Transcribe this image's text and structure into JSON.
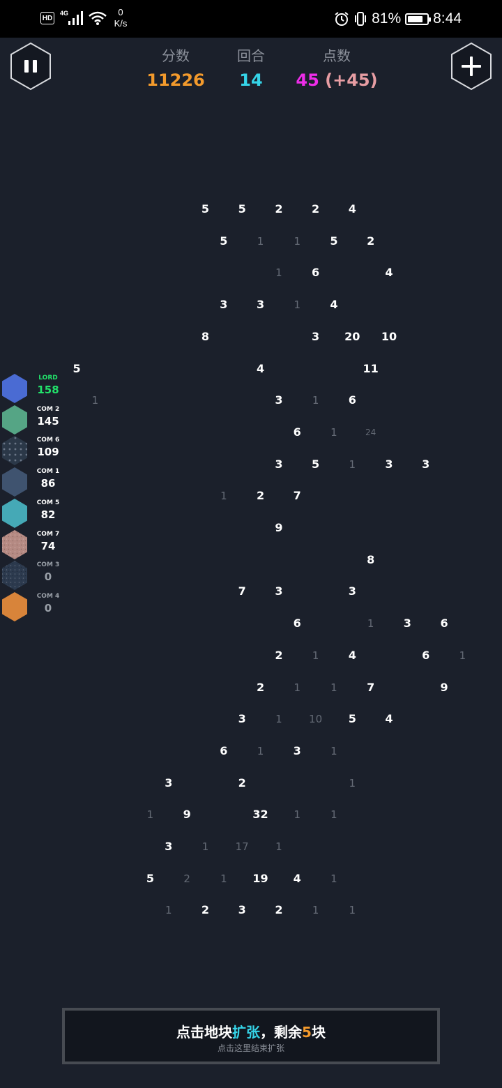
{
  "status_bar": {
    "hd": "HD",
    "network": "4G",
    "speed_value": "0",
    "speed_unit": "K/s",
    "battery": "81%",
    "battery_level": 0.81,
    "time": "8:44"
  },
  "hud": {
    "score_label": "分数",
    "score_value": "11226",
    "round_label": "回合",
    "round_value": "14",
    "points_label": "点数",
    "points_value": "45",
    "points_bonus": "(+45)",
    "colors": {
      "score": "#f39a2c",
      "round": "#35d4e8",
      "points": "#ee2de9",
      "bonus": "#e79da3"
    }
  },
  "board": {
    "cells": [
      {
        "row": 0,
        "col": 0,
        "text": "5"
      },
      {
        "row": 0,
        "col": 2,
        "text": "5"
      },
      {
        "row": 0,
        "col": 4,
        "text": "2"
      },
      {
        "row": 0,
        "col": 6,
        "text": "2"
      },
      {
        "row": 0,
        "col": 8,
        "text": "4"
      },
      {
        "row": 1,
        "col": 1,
        "text": "5"
      },
      {
        "row": 1,
        "col": 3,
        "text": "1",
        "dim": true
      },
      {
        "row": 1,
        "col": 5,
        "text": "1",
        "dim": true
      },
      {
        "row": 1,
        "col": 7,
        "text": "5"
      },
      {
        "row": 1,
        "col": 9,
        "text": "2"
      },
      {
        "row": 2,
        "col": 4,
        "text": "1",
        "dim": true
      },
      {
        "row": 2,
        "col": 6,
        "text": "6"
      },
      {
        "row": 2,
        "col": 10,
        "text": "4"
      },
      {
        "row": 3,
        "col": 1,
        "text": "3"
      },
      {
        "row": 3,
        "col": 3,
        "text": "3"
      },
      {
        "row": 3,
        "col": 5,
        "text": "1",
        "dim": true
      },
      {
        "row": 3,
        "col": 7,
        "text": "4"
      },
      {
        "row": 4,
        "col": 0,
        "text": "8"
      },
      {
        "row": 4,
        "col": 6,
        "text": "3"
      },
      {
        "row": 4,
        "col": 8,
        "text": "20"
      },
      {
        "row": 4,
        "col": 10,
        "text": "10"
      },
      {
        "row": 5,
        "col": -7,
        "text": "5"
      },
      {
        "row": 5,
        "col": 3,
        "text": "4"
      },
      {
        "row": 5,
        "col": 9,
        "text": "11"
      },
      {
        "row": 6,
        "col": -6,
        "text": "1",
        "dim": true
      },
      {
        "row": 6,
        "col": 4,
        "text": "3"
      },
      {
        "row": 6,
        "col": 6,
        "text": "1",
        "dim": true
      },
      {
        "row": 6,
        "col": 8,
        "text": "6"
      },
      {
        "row": 7,
        "col": 5,
        "text": "6"
      },
      {
        "row": 7,
        "col": 7,
        "text": "1",
        "dim": true
      },
      {
        "row": 7,
        "col": 9,
        "text": "24",
        "dim": true,
        "small": true
      },
      {
        "row": 8,
        "col": 4,
        "text": "3"
      },
      {
        "row": 8,
        "col": 6,
        "text": "5"
      },
      {
        "row": 8,
        "col": 8,
        "text": "1",
        "dim": true
      },
      {
        "row": 8,
        "col": 10,
        "text": "3"
      },
      {
        "row": 8,
        "col": 12,
        "text": "3"
      },
      {
        "row": 9,
        "col": 1,
        "text": "1",
        "dim": true
      },
      {
        "row": 9,
        "col": 3,
        "text": "2"
      },
      {
        "row": 9,
        "col": 5,
        "text": "7"
      },
      {
        "row": 10,
        "col": 4,
        "text": "9"
      },
      {
        "row": 11,
        "col": 9,
        "text": "8"
      },
      {
        "row": 12,
        "col": 2,
        "text": "7"
      },
      {
        "row": 12,
        "col": 4,
        "text": "3"
      },
      {
        "row": 12,
        "col": 8,
        "text": "3"
      },
      {
        "row": 13,
        "col": 5,
        "text": "6"
      },
      {
        "row": 13,
        "col": 9,
        "text": "1",
        "dim": true
      },
      {
        "row": 13,
        "col": 11,
        "text": "3"
      },
      {
        "row": 13,
        "col": 13,
        "text": "6"
      },
      {
        "row": 14,
        "col": 4,
        "text": "2"
      },
      {
        "row": 14,
        "col": 6,
        "text": "1",
        "dim": true
      },
      {
        "row": 14,
        "col": 8,
        "text": "4"
      },
      {
        "row": 14,
        "col": 12,
        "text": "6"
      },
      {
        "row": 14,
        "col": 14,
        "text": "1",
        "dim": true
      },
      {
        "row": 15,
        "col": 3,
        "text": "2"
      },
      {
        "row": 15,
        "col": 5,
        "text": "1",
        "dim": true
      },
      {
        "row": 15,
        "col": 7,
        "text": "1",
        "dim": true
      },
      {
        "row": 15,
        "col": 9,
        "text": "7"
      },
      {
        "row": 15,
        "col": 13,
        "text": "9"
      },
      {
        "row": 16,
        "col": 2,
        "text": "3"
      },
      {
        "row": 16,
        "col": 4,
        "text": "1",
        "dim": true
      },
      {
        "row": 16,
        "col": 6,
        "text": "10",
        "dim": true
      },
      {
        "row": 16,
        "col": 8,
        "text": "5"
      },
      {
        "row": 16,
        "col": 10,
        "text": "4"
      },
      {
        "row": 17,
        "col": 1,
        "text": "6"
      },
      {
        "row": 17,
        "col": 3,
        "text": "1",
        "dim": true
      },
      {
        "row": 17,
        "col": 5,
        "text": "3"
      },
      {
        "row": 17,
        "col": 7,
        "text": "1",
        "dim": true
      },
      {
        "row": 18,
        "col": -2,
        "text": "3"
      },
      {
        "row": 18,
        "col": 2,
        "text": "2"
      },
      {
        "row": 18,
        "col": 8,
        "text": "1",
        "dim": true
      },
      {
        "row": 19,
        "col": -3,
        "text": "1",
        "dim": true
      },
      {
        "row": 19,
        "col": -1,
        "text": "9"
      },
      {
        "row": 19,
        "col": 3,
        "text": "32"
      },
      {
        "row": 19,
        "col": 5,
        "text": "1",
        "dim": true
      },
      {
        "row": 19,
        "col": 7,
        "text": "1",
        "dim": true
      },
      {
        "row": 20,
        "col": -2,
        "text": "3"
      },
      {
        "row": 20,
        "col": 0,
        "text": "1",
        "dim": true
      },
      {
        "row": 20,
        "col": 2,
        "text": "17",
        "dim": true
      },
      {
        "row": 20,
        "col": 4,
        "text": "1",
        "dim": true
      },
      {
        "row": 21,
        "col": -3,
        "text": "5"
      },
      {
        "row": 21,
        "col": -1,
        "text": "2",
        "dim": true
      },
      {
        "row": 21,
        "col": 1,
        "text": "1",
        "dim": true
      },
      {
        "row": 21,
        "col": 3,
        "text": "19"
      },
      {
        "row": 21,
        "col": 5,
        "text": "4"
      },
      {
        "row": 21,
        "col": 7,
        "text": "1",
        "dim": true
      },
      {
        "row": 22,
        "col": -2,
        "text": "1",
        "dim": true
      },
      {
        "row": 22,
        "col": 0,
        "text": "2"
      },
      {
        "row": 22,
        "col": 2,
        "text": "3"
      },
      {
        "row": 22,
        "col": 4,
        "text": "2"
      },
      {
        "row": 22,
        "col": 6,
        "text": "1",
        "dim": true
      },
      {
        "row": 22,
        "col": 8,
        "text": "1",
        "dim": true
      }
    ]
  },
  "players": [
    {
      "name": "LORD",
      "value": "158",
      "color": "#4a6bd3",
      "name_color": "#22e36b",
      "value_color": "#22e36b",
      "pattern": "solid"
    },
    {
      "name": "COM 2",
      "value": "145",
      "color": "#55a585",
      "pattern": "solid"
    },
    {
      "name": "COM 6",
      "value": "109",
      "color": "#2b3848",
      "pattern": "dots"
    },
    {
      "name": "COM 1",
      "value": "86",
      "color": "#3f536f",
      "pattern": "solid"
    },
    {
      "name": "COM 5",
      "value": "82",
      "color": "#45a9b6",
      "pattern": "solid"
    },
    {
      "name": "COM 7",
      "value": "74",
      "color": "#b58a83",
      "pattern": "speckle"
    },
    {
      "name": "COM 3",
      "value": "0",
      "color": "#2c3a4e",
      "pattern": "speckle",
      "inactive": true
    },
    {
      "name": "COM 4",
      "value": "0",
      "color": "#d8843a",
      "pattern": "solid",
      "inactive": true
    }
  ],
  "bottom_bar": {
    "prefix": "点击地块",
    "action": "扩张",
    "middle": "，剩余",
    "count": "5",
    "suffix": "块",
    "hint": "点击这里结束扩张",
    "action_color": "#35d4e8",
    "count_color": "#f39a2c"
  }
}
